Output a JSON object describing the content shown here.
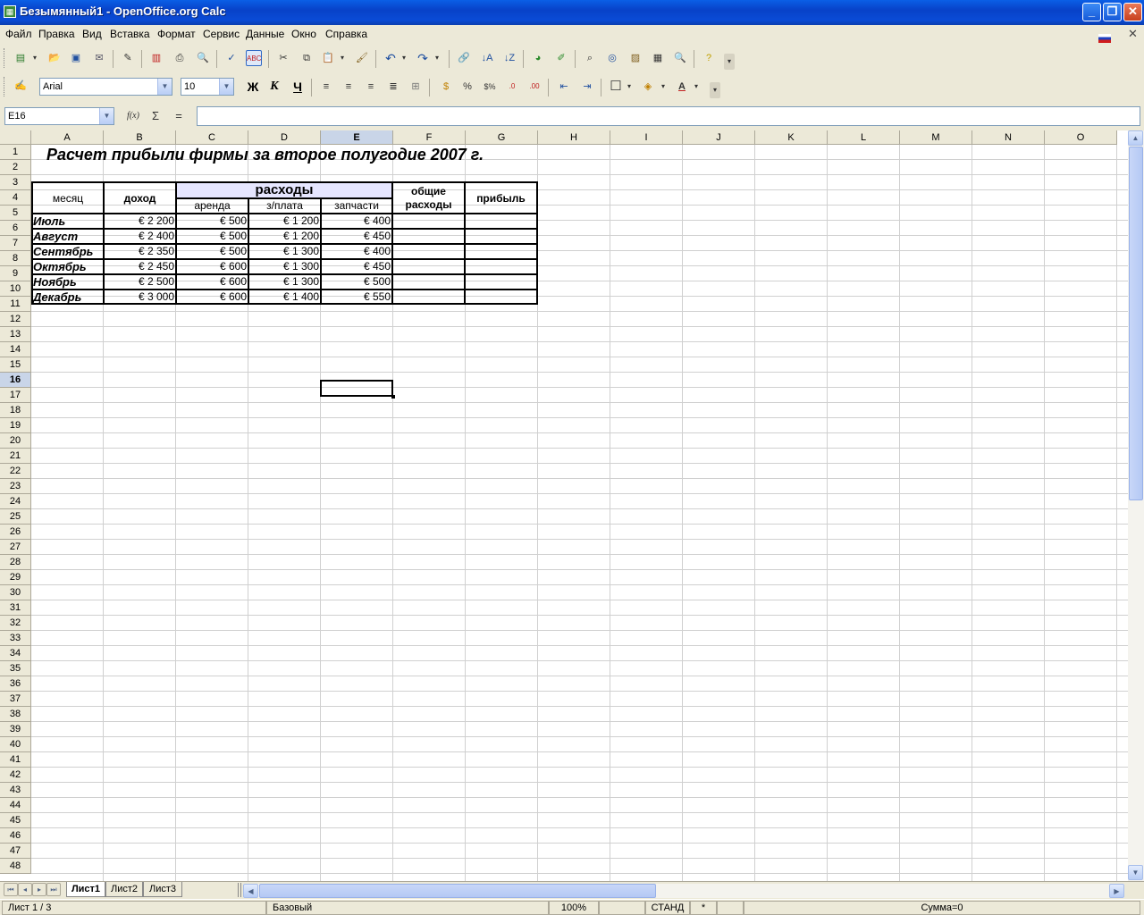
{
  "window": {
    "title": "Безымянный1 - OpenOffice.org Calc",
    "min": "_",
    "max": "❐",
    "close": "✕"
  },
  "menu": [
    "Файл",
    "Правка",
    "Вид",
    "Вставка",
    "Формат",
    "Сервис",
    "Данные",
    "Окно",
    "Справка"
  ],
  "format_bar": {
    "font_name": "Arial",
    "font_size": "10",
    "bold": "Ж",
    "italic": "К",
    "underline": "Ч"
  },
  "formula_bar": {
    "cell_ref": "E16",
    "func_icon": "f(x)",
    "sum_icon": "Σ",
    "equals_icon": "=",
    "content": ""
  },
  "columns": [
    "A",
    "B",
    "C",
    "D",
    "E",
    "F",
    "G",
    "H",
    "I",
    "J",
    "K",
    "L",
    "M",
    "N",
    "O"
  ],
  "selected_col": "E",
  "selected_row": 16,
  "rows": [
    "1",
    "2",
    "3",
    "4",
    "5",
    "6",
    "7",
    "8",
    "9",
    "10",
    "11",
    "12",
    "13",
    "14",
    "15",
    "16",
    "17",
    "18",
    "19",
    "20",
    "21",
    "22",
    "23",
    "24",
    "25",
    "26",
    "27",
    "28",
    "29",
    "30",
    "31",
    "32",
    "33",
    "34",
    "35",
    "36",
    "37",
    "38",
    "39",
    "40",
    "41",
    "42",
    "43",
    "44",
    "45",
    "46",
    "47",
    "48"
  ],
  "table": {
    "title": "Расчет прибыли фирмы за второе полугодие 2007 г.",
    "h_month": "месяц",
    "h_income": "доход",
    "h_expenses": "расходы",
    "h_rent": "аренда",
    "h_salary": "з/плата",
    "h_parts": "запчасти",
    "h_total_line1": "общие",
    "h_total_line2": "расходы",
    "h_profit": "прибыль",
    "data": [
      {
        "month": "Июль",
        "income": "€ 2 200",
        "rent": "€ 500",
        "salary": "€ 1 200",
        "parts": "€ 400"
      },
      {
        "month": "Август",
        "income": "€ 2 400",
        "rent": "€ 500",
        "salary": "€ 1 200",
        "parts": "€ 450"
      },
      {
        "month": "Сентябрь",
        "income": "€ 2 350",
        "rent": "€ 500",
        "salary": "€ 1 300",
        "parts": "€ 400"
      },
      {
        "month": "Октябрь",
        "income": "€ 2 450",
        "rent": "€ 600",
        "salary": "€ 1 300",
        "parts": "€ 450"
      },
      {
        "month": "Ноябрь",
        "income": "€ 2 500",
        "rent": "€ 600",
        "salary": "€ 1 300",
        "parts": "€ 500"
      },
      {
        "month": "Декабрь",
        "income": "€ 3 000",
        "rent": "€ 600",
        "salary": "€ 1 400",
        "parts": "€ 550"
      }
    ]
  },
  "sheets": [
    "Лист1",
    "Лист2",
    "Лист3"
  ],
  "active_sheet": "Лист1",
  "status": {
    "sheet": "Лист 1 / 3",
    "style": "Базовый",
    "zoom": "100%",
    "mode": "СТАНД",
    "modified": "*",
    "sum": "Сумма=0"
  },
  "colors": {
    "title_bar": "#0A4BD6",
    "chrome": "#ECE9D8",
    "expenses_header_bg": "#E6E6FF",
    "selection_header": "#C9D5E8"
  }
}
